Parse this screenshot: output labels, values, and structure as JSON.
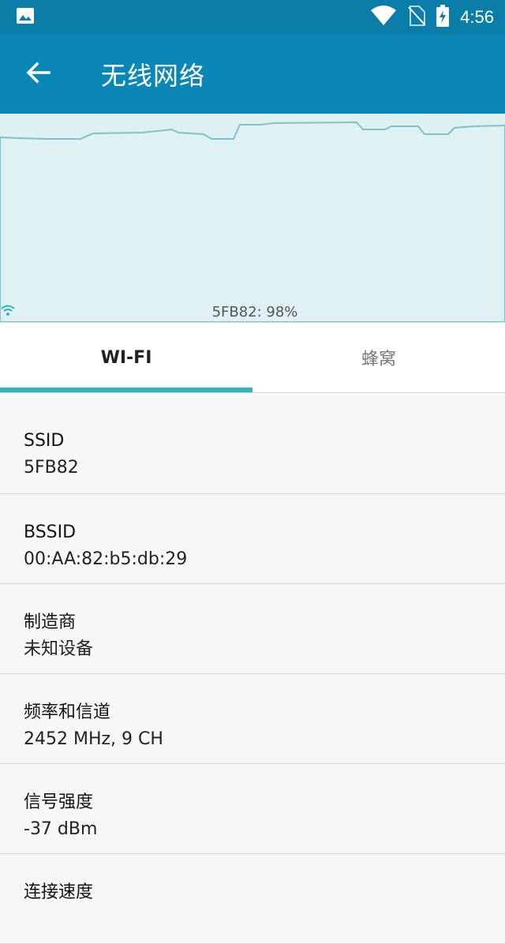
{
  "status_bar": {
    "time": "4:56"
  },
  "app_bar": {
    "title": "无线网络"
  },
  "graph": {
    "label": "5FB82: 98%",
    "fill_color": "#ddf0f2",
    "line_color": "#7fc4c9"
  },
  "tabs": [
    {
      "label": "WI-FI",
      "active": true
    },
    {
      "label": "蜂窝",
      "active": false
    }
  ],
  "info": [
    {
      "label": "SSID",
      "value": "5FB82"
    },
    {
      "label": "BSSID",
      "value": "00:AA:82:b5:db:29"
    },
    {
      "label": "制造商",
      "value": "未知设备"
    },
    {
      "label": "频率和信道",
      "value": "2452 MHz, 9 CH"
    },
    {
      "label": "信号强度",
      "value": "-37 dBm"
    },
    {
      "label": "连接速度",
      "value": ""
    }
  ],
  "colors": {
    "app_bar": "#0a87b6",
    "status_bar": "#0a7ea8",
    "accent": "#2fb3bd"
  }
}
